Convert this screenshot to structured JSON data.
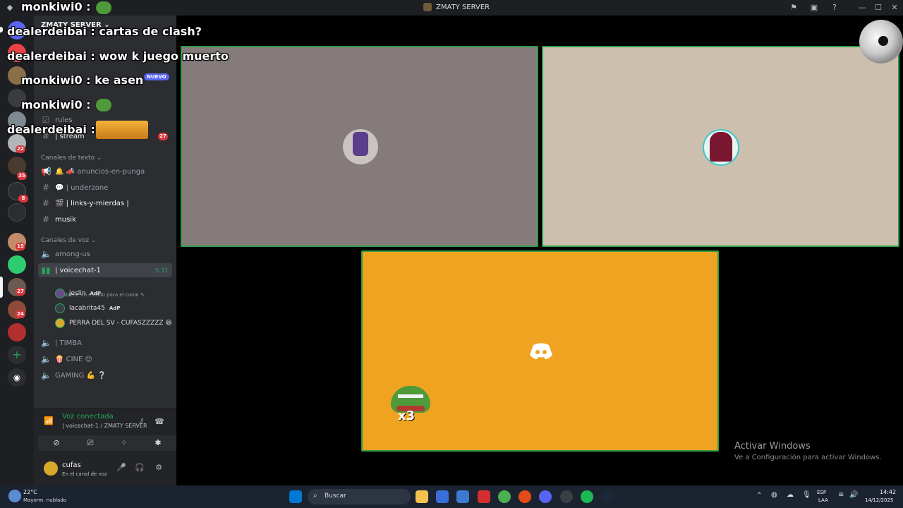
{
  "window": {
    "title": "ZMATY SERVER",
    "controls": {
      "minimize": "—",
      "maximize": "☐",
      "close": "✕"
    }
  },
  "server": {
    "name": "ZMATY SERVER"
  },
  "rail": {
    "badges": [
      "22",
      "35",
      "8",
      "15",
      "27",
      "24"
    ]
  },
  "channels": {
    "top_items": [
      {
        "label": "rules"
      },
      {
        "label": "| stream",
        "badge": "27"
      }
    ],
    "text_category": "Canales de texto",
    "text_channels": [
      {
        "label": "🔔 📣 anuncios-en-punga"
      },
      {
        "label": "💬 | underzone"
      },
      {
        "label": "🎬 | links-y-mierdas |"
      },
      {
        "label": "musik"
      }
    ],
    "voice_category": "Canales de voz",
    "voice_channels_before": [
      {
        "label": "among-us"
      }
    ],
    "active_voice": {
      "label": "| voicechat-1",
      "time": "5:31",
      "subtitle": "Establece un estado para el canal"
    },
    "voice_users": [
      {
        "name": "jeslin",
        "tag": "AdP"
      },
      {
        "name": "lacabrita45",
        "tag": "AdP"
      },
      {
        "name": "PERRA DEL SV - CUFASZZZZZ 😆",
        "tag": ""
      }
    ],
    "voice_channels_after": [
      {
        "label": "| TIMBA"
      },
      {
        "label": "🍿 CINE 😍"
      },
      {
        "label": "GAMING 💪 ❔"
      }
    ]
  },
  "voice_panel": {
    "status": "Voz conectada",
    "channel": "| voicechat-1 / ZMATY SERVER"
  },
  "user_panel": {
    "name": "cufas",
    "status": "En el canal de voz"
  },
  "stream": {
    "tile_colors": [
      "#857b7b",
      "#ccbfae",
      "#f0a321"
    ],
    "border_color": "#2f9e44",
    "discord_logo_icon": "discord-logo-icon"
  },
  "chat_overlay": [
    {
      "user": "monkiwi0",
      "message": "",
      "has_emote": true
    },
    {
      "user": "dealerdeibai",
      "message": "cartas de clash?",
      "has_emote": false
    },
    {
      "user": "dealerdeibai",
      "message": "wow k juego muerto",
      "has_emote": false
    },
    {
      "user": "monkiwi0",
      "message": "ke asen",
      "has_emote": false
    },
    {
      "user": "monkiwi0",
      "message": "",
      "has_emote": true
    },
    {
      "user": "dealerdeibai",
      "message": "",
      "has_emote": true
    }
  ],
  "chat_labels": [
    "monkiwi0 :",
    "dealerdeibai : cartas de clash?",
    "dealerdeibai : wow k juego muerto",
    "monkiwi0 : ke asen",
    "monkiwi0 :",
    "dealerdeibai :"
  ],
  "badges": {
    "nuevo": "NUEVO"
  },
  "watermark": {
    "title": "Activar Windows",
    "subtitle": "Ve a Configuración para activar Windows."
  },
  "taskbar": {
    "weather_temp": "22°C",
    "weather_desc": "Mayorm. nublado",
    "search_placeholder": "Buscar",
    "lang_top": "ESP",
    "lang_bottom": "LAA",
    "time": "14:42",
    "date": "14/12/2025"
  }
}
